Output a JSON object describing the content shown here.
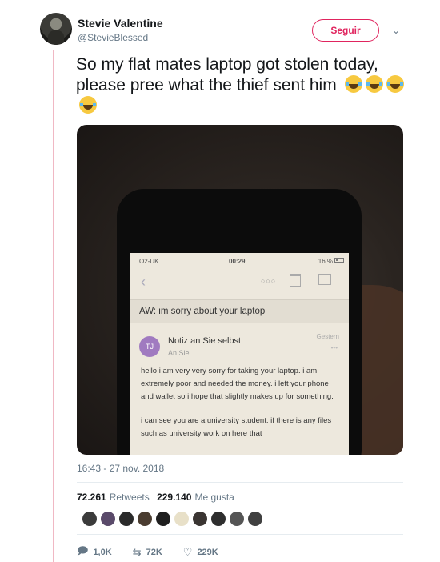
{
  "user": {
    "display_name": "Stevie Valentine",
    "handle": "@StevieBlessed",
    "follow_label": "Seguir"
  },
  "tweet": {
    "text": "So my flat mates laptop got stolen today, please pree what the thief sent him",
    "emoji_icon": "face-with-tears-of-joy-icon",
    "timestamp": "16:43 - 27 nov. 2018"
  },
  "photo": {
    "status_bar": {
      "carrier": "O2-UK",
      "time": "00:29",
      "battery": "16 %"
    },
    "email": {
      "subject": "AW: im sorry about your laptop",
      "sender_initials": "TJ",
      "sender": "Notiz an Sie selbst",
      "recipient": "An Sie",
      "date": "Gestern",
      "body": [
        "hello i am very very sorry for taking your laptop. i am extremely poor and needed the money. i left your phone and wallet so i hope that slightly makes up for something.",
        "i can see you are a university student. if there is any files such as university work on here that"
      ]
    }
  },
  "stats": {
    "retweets_count": "72.261",
    "retweets_label": "Retweets",
    "likes_count": "229.140",
    "likes_label": "Me gusta"
  },
  "likers": [
    "#3b3b3b",
    "#5a4a6a",
    "#2a2a2a",
    "#4a3c30",
    "#1f1f1f",
    "#e8e0c8",
    "#3a3532",
    "#2e2e2e",
    "#555555",
    "#404040"
  ],
  "actions": {
    "reply_count": "1,0K",
    "retweet_count": "72K",
    "like_count": "229K"
  },
  "colors": {
    "accent": "#e0245e",
    "secondary_text": "#657786",
    "thread_line": "#f0b8c4"
  }
}
